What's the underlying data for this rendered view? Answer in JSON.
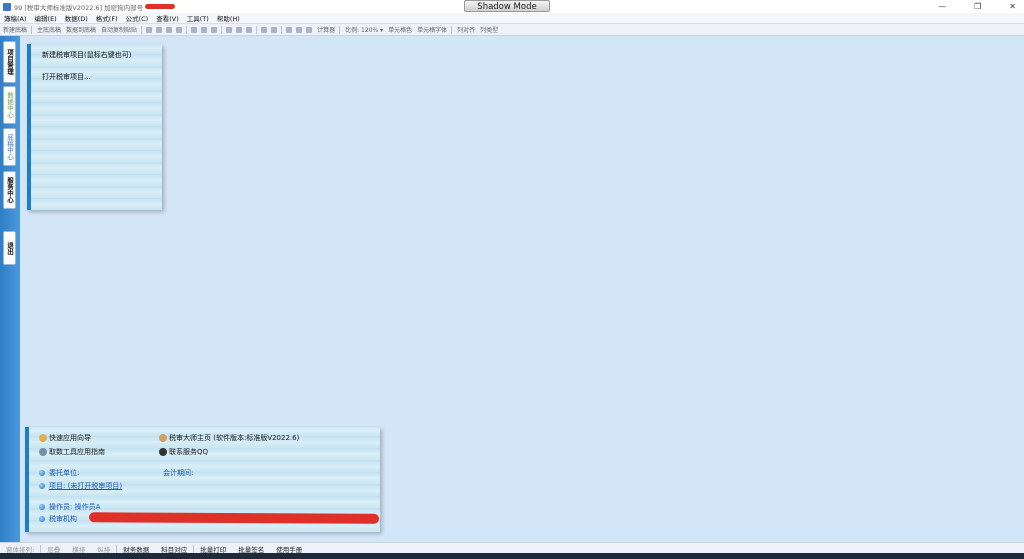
{
  "window": {
    "title": "99 [税审大师标准版V2022.6] 加密狗内部号",
    "shadow_mode": "Shadow Mode",
    "controls": [
      "—",
      "❐",
      "✕"
    ]
  },
  "menu": [
    "簿稿(A)",
    "编辑(E)",
    "数据(D)",
    "格式(F)",
    "公式(C)",
    "查看(V)",
    "工具(T)",
    "帮助(H)"
  ],
  "toolbar": {
    "left": [
      "新建底稿",
      "主底底稿",
      "数据到底稿",
      "自动复制贴贴"
    ],
    "right": [
      "计算器",
      "比例: 120% ▾",
      "单元格色",
      "单元格字体",
      "列对齐",
      "列类型"
    ]
  },
  "sidebar": {
    "tabs": [
      {
        "label": "项目管理"
      },
      {
        "label": "数据中心"
      },
      {
        "label": "底稿中心"
      },
      {
        "label": "服务中心"
      },
      {
        "label": "退出"
      }
    ]
  },
  "top_panel": {
    "new_project": "新建税审项目(鼠标右键也可)",
    "open_project": "打开税审项目..."
  },
  "bottom_panel": {
    "quick_guide": "快速应用向导",
    "home_page": "税审大师主页 (软件版本:标准版V2022.6)",
    "data_tool_guide": "取数工具应用指南",
    "contact_qq": "联系服务QQ",
    "client_label": "委托单位:",
    "period_label": "会计期间:",
    "project_label": "项目: (未打开税审项目)",
    "operator_label": "操作员: 操作员A",
    "agency_label": "税审机构"
  },
  "statusbar": {
    "items": [
      "窗体排列:",
      "层叠",
      "横排",
      "纵排",
      "财务数据",
      "科目对应",
      "批量打印",
      "批量签名",
      "使用手册"
    ]
  },
  "colors": {
    "background": "#d3e6f7",
    "sidebar": "#2f7fc8",
    "panel_accent": "#1d7fc2",
    "redaction": "#e0302a"
  }
}
